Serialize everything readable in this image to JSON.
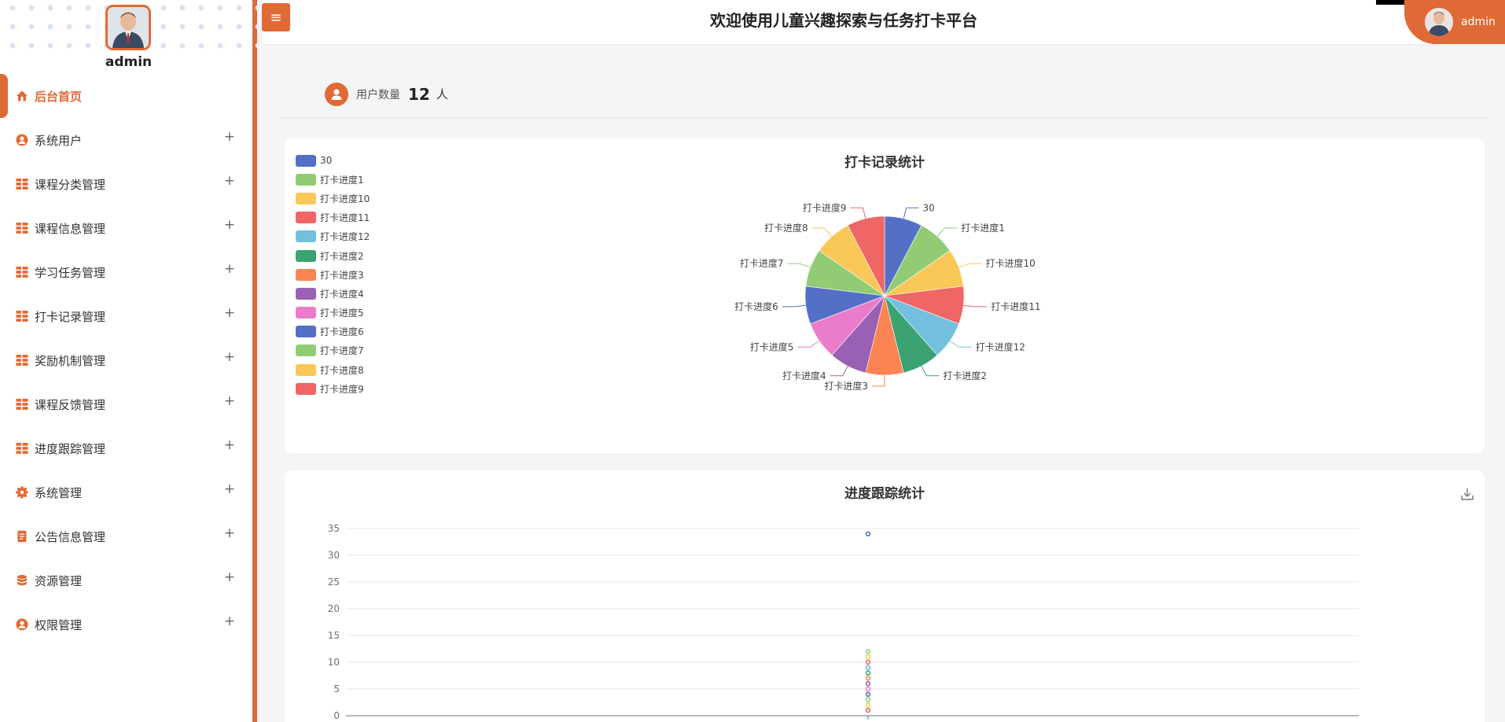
{
  "sidebar": {
    "admin_name": "admin",
    "items": [
      {
        "label": "后台首页",
        "icon": "home-icon",
        "active": true,
        "expand": ""
      },
      {
        "label": "系统用户",
        "icon": "user-icon",
        "active": false,
        "expand": "+"
      },
      {
        "label": "课程分类管理",
        "icon": "grid-icon",
        "active": false,
        "expand": "+"
      },
      {
        "label": "课程信息管理",
        "icon": "grid-icon",
        "active": false,
        "expand": "+"
      },
      {
        "label": "学习任务管理",
        "icon": "grid-icon",
        "active": false,
        "expand": "+"
      },
      {
        "label": "打卡记录管理",
        "icon": "grid-icon",
        "active": false,
        "expand": "+"
      },
      {
        "label": "奖励机制管理",
        "icon": "grid-icon",
        "active": false,
        "expand": "+"
      },
      {
        "label": "课程反馈管理",
        "icon": "grid-icon",
        "active": false,
        "expand": "+"
      },
      {
        "label": "进度跟踪管理",
        "icon": "grid-icon",
        "active": false,
        "expand": "+"
      },
      {
        "label": "系统管理",
        "icon": "gear-icon",
        "active": false,
        "expand": "+"
      },
      {
        "label": "公告信息管理",
        "icon": "document-icon",
        "active": false,
        "expand": "+"
      },
      {
        "label": "资源管理",
        "icon": "database-icon",
        "active": false,
        "expand": "+"
      },
      {
        "label": "权限管理",
        "icon": "user-icon",
        "active": false,
        "expand": "+"
      }
    ]
  },
  "header": {
    "toggle_glyph": "≡",
    "title": "欢迎使用儿童兴趣探索与任务打卡平台",
    "user_label": "admin"
  },
  "stats": {
    "label": "用户数量",
    "value": "12",
    "unit": "人"
  },
  "colors": {
    "accent": "#e06a35",
    "palette": [
      "#5470c6",
      "#91cc75",
      "#fac858",
      "#ee6666",
      "#73c0de",
      "#3ba272",
      "#fc8452",
      "#9a60b4",
      "#ea7ccc",
      "#5470c6",
      "#91cc75",
      "#fac858",
      "#ee6666"
    ]
  },
  "chart_data": [
    {
      "type": "pie",
      "title": "打卡记录统计",
      "legend_position": "top-left",
      "categories": [
        "30",
        "打卡进度1",
        "打卡进度10",
        "打卡进度11",
        "打卡进度12",
        "打卡进度2",
        "打卡进度3",
        "打卡进度4",
        "打卡进度5",
        "打卡进度6",
        "打卡进度7",
        "打卡进度8",
        "打卡进度9"
      ],
      "values": [
        1,
        1,
        1,
        1,
        1,
        1,
        1,
        1,
        1,
        1,
        1,
        1,
        1
      ]
    },
    {
      "type": "scatter",
      "title": "进度跟踪统计",
      "ylim": [
        0,
        35
      ],
      "yticks": [
        0,
        5,
        10,
        15,
        20,
        25,
        30,
        35
      ],
      "grid": true,
      "points": [
        34,
        12,
        11,
        10,
        9,
        8,
        7,
        6,
        5,
        4,
        3,
        2,
        1
      ]
    }
  ]
}
